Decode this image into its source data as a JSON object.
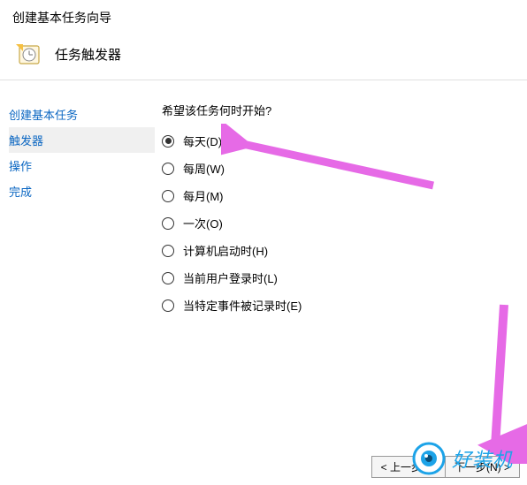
{
  "header": {
    "title": "创建基本任务向导",
    "sub": "任务触发器"
  },
  "sidebar": {
    "items": [
      {
        "label": "创建基本任务",
        "active": false
      },
      {
        "label": "触发器",
        "active": true
      },
      {
        "label": "操作",
        "active": false
      },
      {
        "label": "完成",
        "active": false
      }
    ]
  },
  "main": {
    "question": "希望该任务何时开始?",
    "options": [
      {
        "label": "每天(D)",
        "selected": true
      },
      {
        "label": "每周(W)",
        "selected": false
      },
      {
        "label": "每月(M)",
        "selected": false
      },
      {
        "label": "一次(O)",
        "selected": false
      },
      {
        "label": "计算机启动时(H)",
        "selected": false
      },
      {
        "label": "当前用户登录时(L)",
        "selected": false
      },
      {
        "label": "当特定事件被记录时(E)",
        "selected": false
      }
    ]
  },
  "footer": {
    "back": "< 上一步(B)",
    "next": "下一步(N) >"
  },
  "watermark": {
    "text": "好装机"
  }
}
